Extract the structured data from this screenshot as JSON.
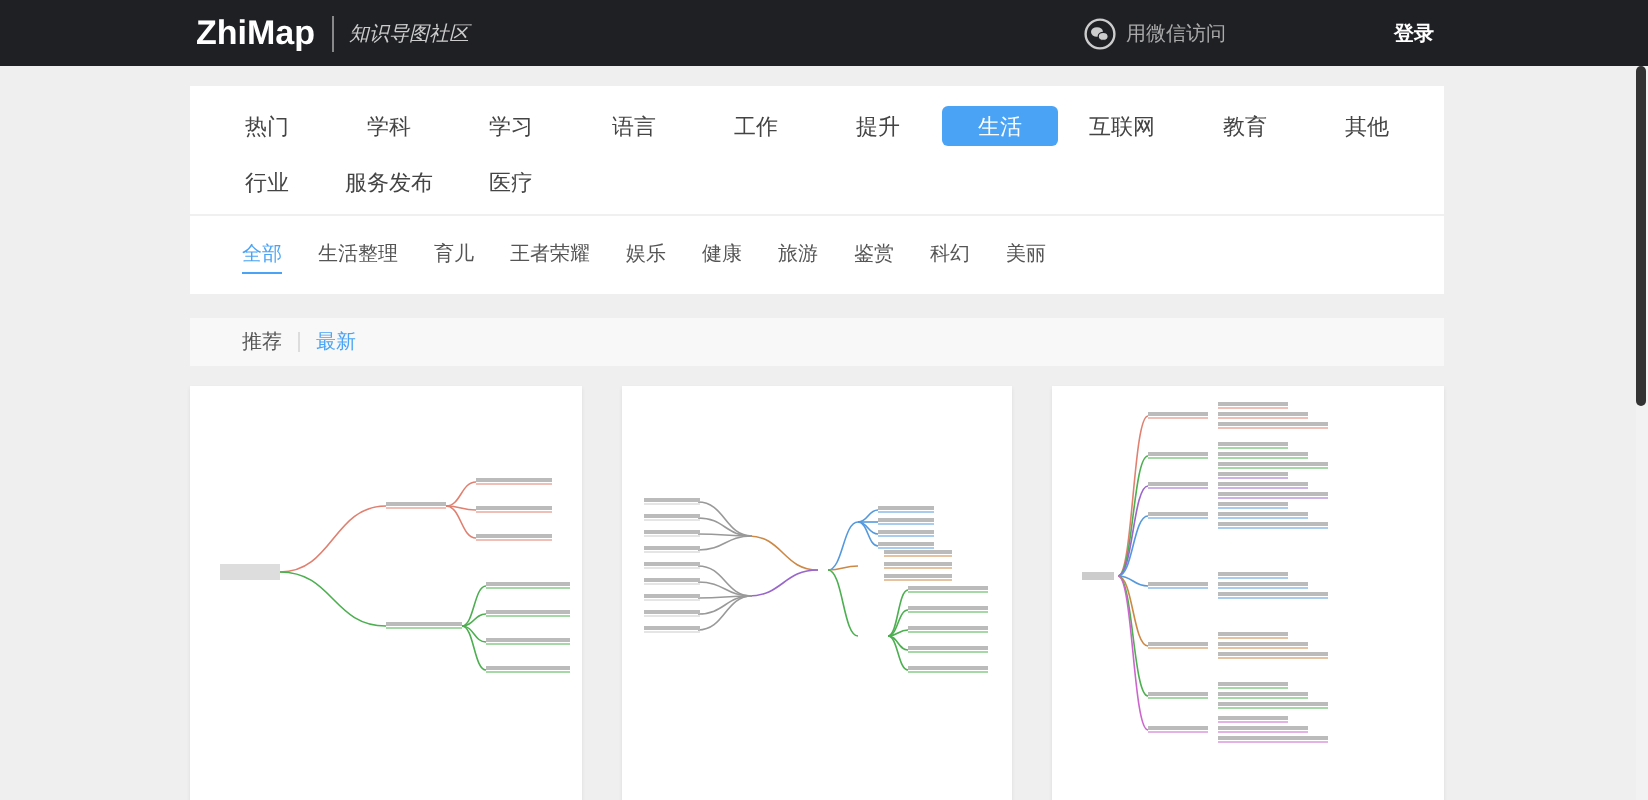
{
  "header": {
    "logo": "ZhiMap",
    "tagline": "知识导图社区",
    "wechat_login": "用微信访问",
    "login": "登录"
  },
  "categories": [
    {
      "label": "热门",
      "selected": false
    },
    {
      "label": "学科",
      "selected": false
    },
    {
      "label": "学习",
      "selected": false
    },
    {
      "label": "语言",
      "selected": false
    },
    {
      "label": "工作",
      "selected": false
    },
    {
      "label": "提升",
      "selected": false
    },
    {
      "label": "生活",
      "selected": true
    },
    {
      "label": "互联网",
      "selected": false
    },
    {
      "label": "教育",
      "selected": false
    },
    {
      "label": "其他",
      "selected": false
    },
    {
      "label": "行业",
      "selected": false
    },
    {
      "label": "服务发布",
      "selected": false
    },
    {
      "label": "医疗",
      "selected": false
    }
  ],
  "subcategories": [
    {
      "label": "全部",
      "selected": true
    },
    {
      "label": "生活整理",
      "selected": false
    },
    {
      "label": "育儿",
      "selected": false
    },
    {
      "label": "王者荣耀",
      "selected": false
    },
    {
      "label": "娱乐",
      "selected": false
    },
    {
      "label": "健康",
      "selected": false
    },
    {
      "label": "旅游",
      "selected": false
    },
    {
      "label": "鉴赏",
      "selected": false
    },
    {
      "label": "科幻",
      "selected": false
    },
    {
      "label": "美丽",
      "selected": false
    }
  ],
  "sort_tabs": [
    {
      "label": "推荐",
      "selected": false
    },
    {
      "label": "最新",
      "selected": true
    }
  ],
  "cards": [
    {
      "kind": "mind-map"
    },
    {
      "kind": "mind-map"
    },
    {
      "kind": "mind-map"
    }
  ]
}
